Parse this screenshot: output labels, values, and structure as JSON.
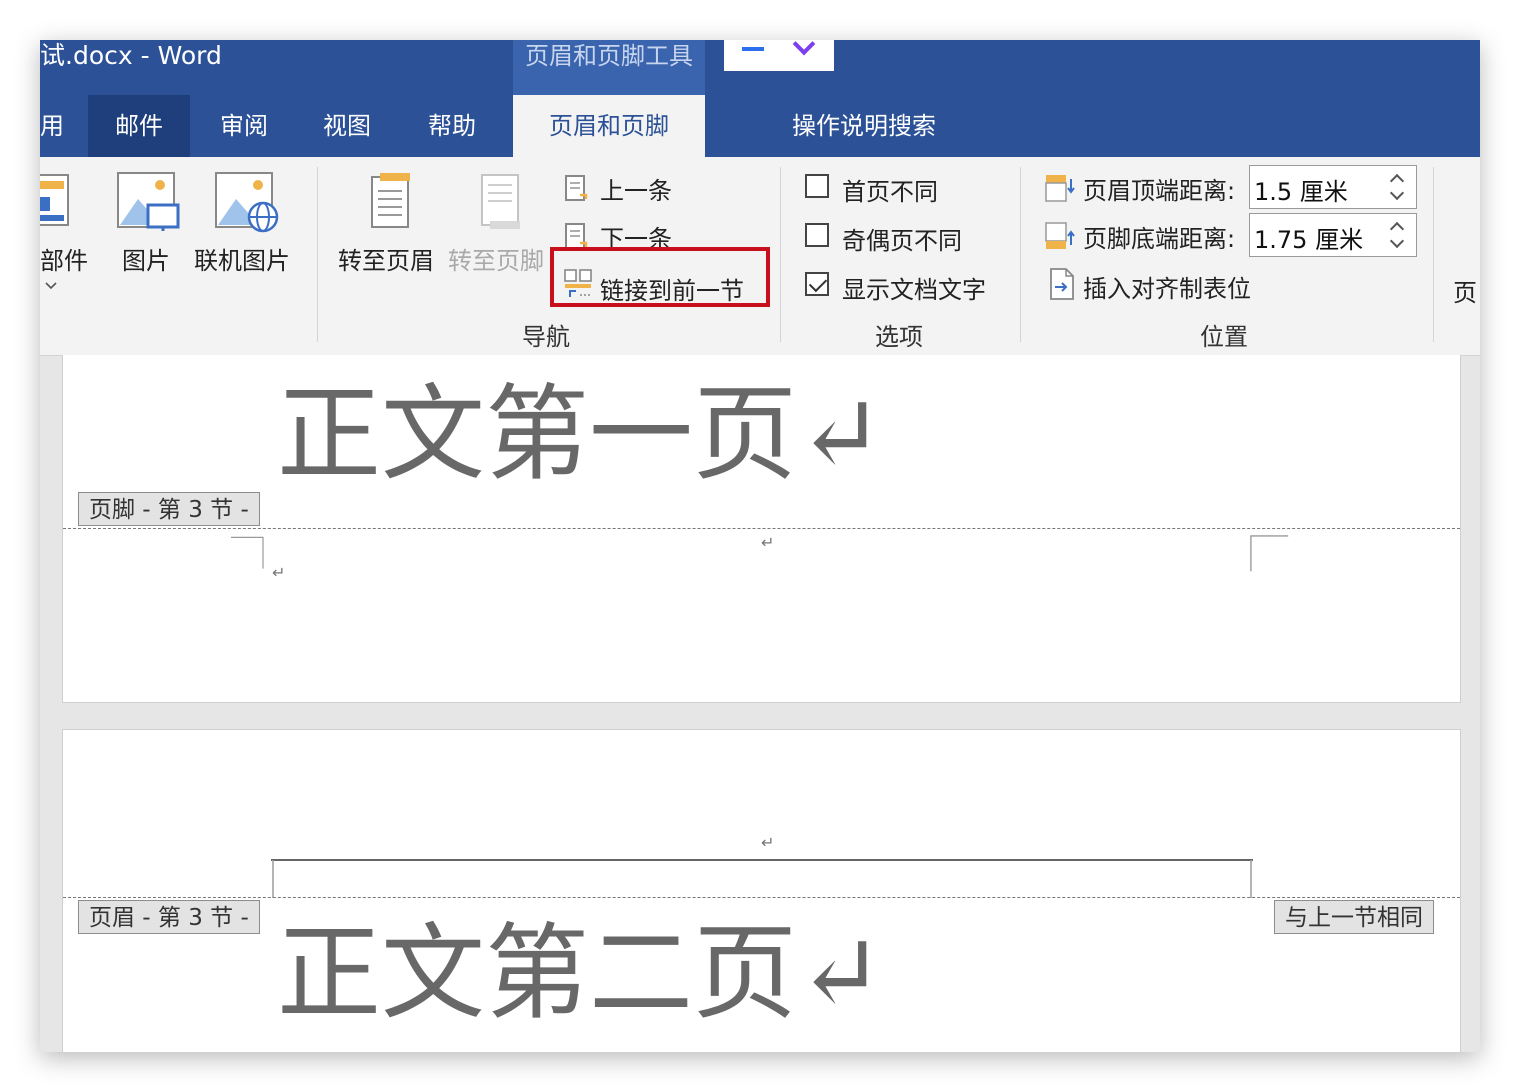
{
  "window": {
    "title": "试.docx  -  Word",
    "contextual_tab_group": "页眉和页脚工具",
    "accent_color": "#2c5197"
  },
  "tabs": [
    {
      "label": "用"
    },
    {
      "label": "邮件"
    },
    {
      "label": "审阅"
    },
    {
      "label": "视图"
    },
    {
      "label": "帮助"
    },
    {
      "label": "页眉和页脚"
    }
  ],
  "search": {
    "label": "操作说明搜索",
    "icon": "lightbulb-icon"
  },
  "ribbon": {
    "insert": {
      "parts_label": "部件",
      "picture_label": "图片",
      "online_picture_label": "联机图片"
    },
    "navigation": {
      "goto_header": "转至页眉",
      "goto_footer": "转至页脚",
      "previous": "上一条",
      "next": "下一条",
      "link_to_previous": "链接到前一节",
      "group_label": "导航"
    },
    "options": {
      "different_first": "首页不同",
      "different_odd_even": "奇偶页不同",
      "show_document_text": "显示文档文字",
      "group_label": "选项"
    },
    "position": {
      "header_top_label": "页眉顶端距离:",
      "header_top_value": "1.5 厘米",
      "footer_bottom_label": "页脚底端距离:",
      "footer_bottom_value": "1.75 厘米",
      "insert_alignment_tab": "插入对齐制表位",
      "group_label": "位置"
    },
    "close_partial": "页"
  },
  "document": {
    "page1_text": "正文第一页↵",
    "footer_tag": "页脚 - 第 3 节 -",
    "header_tag": "页眉 - 第 3 节 -",
    "same_as_previous": "与上一节相同",
    "page2_text": "正文第二页↵",
    "paragraph_mark": "↵"
  }
}
